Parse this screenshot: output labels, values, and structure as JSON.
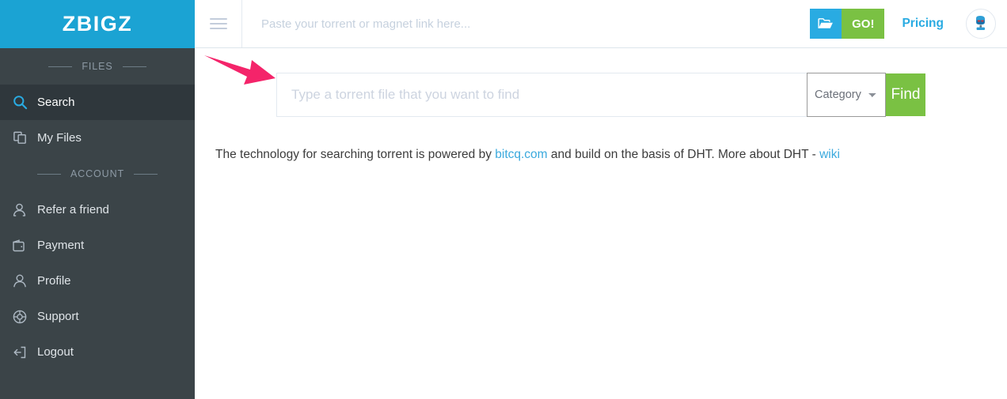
{
  "brand": {
    "logo_text": "ZBIGZ",
    "logo_bg": "#1ba3d3"
  },
  "colors": {
    "accent_blue": "#29abe2",
    "accent_green": "#7ac143",
    "sidebar_bg": "#3b4448",
    "sidebar_active_bg": "#2f373c",
    "link_blue": "#3aa9dd",
    "arrow_pink": "#f4246a"
  },
  "sidebar": {
    "sections": [
      {
        "label": "FILES"
      },
      {
        "label": "ACCOUNT"
      }
    ],
    "files_items": [
      {
        "label": "Search",
        "icon": "search-icon",
        "active": true
      },
      {
        "label": "My Files",
        "icon": "files-icon",
        "active": false
      }
    ],
    "account_items": [
      {
        "label": "Refer a friend",
        "icon": "refer-friend-icon",
        "active": false
      },
      {
        "label": "Payment",
        "icon": "wallet-icon",
        "active": false
      },
      {
        "label": "Profile",
        "icon": "user-icon",
        "active": false
      },
      {
        "label": "Support",
        "icon": "lifebuoy-icon",
        "active": false
      },
      {
        "label": "Logout",
        "icon": "logout-icon",
        "active": false
      }
    ]
  },
  "header": {
    "menu_icon": "hamburger-icon",
    "paste_input": {
      "placeholder": "Paste your torrent or magnet link here...",
      "value": ""
    },
    "folder_button_icon": "folder-open-icon",
    "go_label": "GO!",
    "pricing_label": "Pricing",
    "avatar_icon": "robot-avatar-icon"
  },
  "main": {
    "search": {
      "placeholder": "Type a torrent file that you want to find",
      "value": "",
      "category_selected": "Category",
      "category_options": [
        "Category"
      ],
      "find_label": "Find"
    },
    "info": {
      "part1": "The technology for searching torrent is powered by ",
      "link1": "bitcq.com",
      "part2": " and build on the basis of DHT. More about DHT - ",
      "link2": "wiki"
    }
  },
  "annotation": {
    "arrow_name": "red-arrow-pointer",
    "points_to": "Type a torrent file that you want to find"
  }
}
